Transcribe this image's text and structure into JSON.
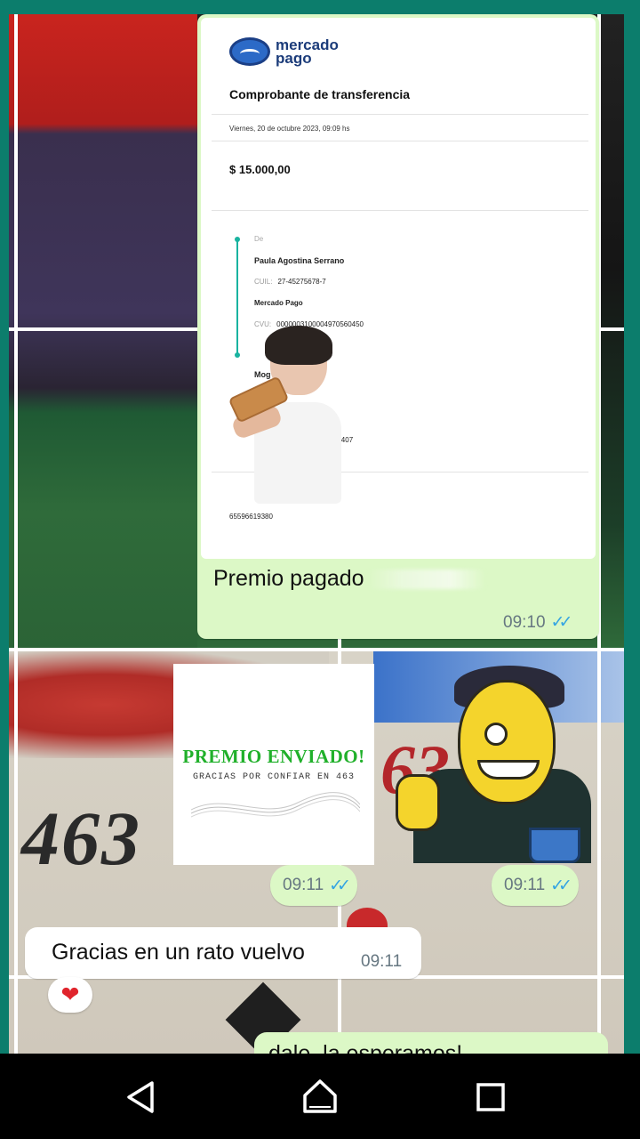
{
  "receipt": {
    "brand_line1": "mercado",
    "brand_line2": "pago",
    "title": "Comprobante de transferencia",
    "date": "Viernes, 20 de octubre 2023, 09:09 hs",
    "amount": "$ 15.000,00",
    "from_label": "De",
    "sender_name": "Paula Agostina Serrano",
    "cuil_label": "CUIL:",
    "cuil_value": "27-45275678-7",
    "bank": "Mercado Pago",
    "cvu_label": "CVU:",
    "cvu_value": "0000003100004970560450",
    "to_partial": "Mog",
    "account_partial": "9541407",
    "operation_number": "65596619380"
  },
  "messages": {
    "receipt_caption": "Premio pagado",
    "receipt_time": "09:10",
    "premio_time": "09:11",
    "sticker_time": "09:11",
    "incoming_text": "Gracias en un rato vuelvo",
    "incoming_time": "09:11",
    "reaction": "❤",
    "partial_outgoing": "dale, la esperamos!"
  },
  "premio_image": {
    "title": "PREMIO ENVIADO!",
    "subtitle": "GRACIAS POR CONFIAR EN 463"
  },
  "wallpaper": {
    "number_left": "463",
    "number_right": "63"
  },
  "icons": {
    "read_ticks": "double-check-icon",
    "nav_back": "back-triangle-icon",
    "nav_home": "home-icon",
    "nav_recent": "recent-apps-icon"
  },
  "colors": {
    "outgoing_bubble": "#dcf8c6",
    "incoming_bubble": "#ffffff",
    "tick_blue": "#34a4e2",
    "frame_teal": "#0c7d6c"
  }
}
